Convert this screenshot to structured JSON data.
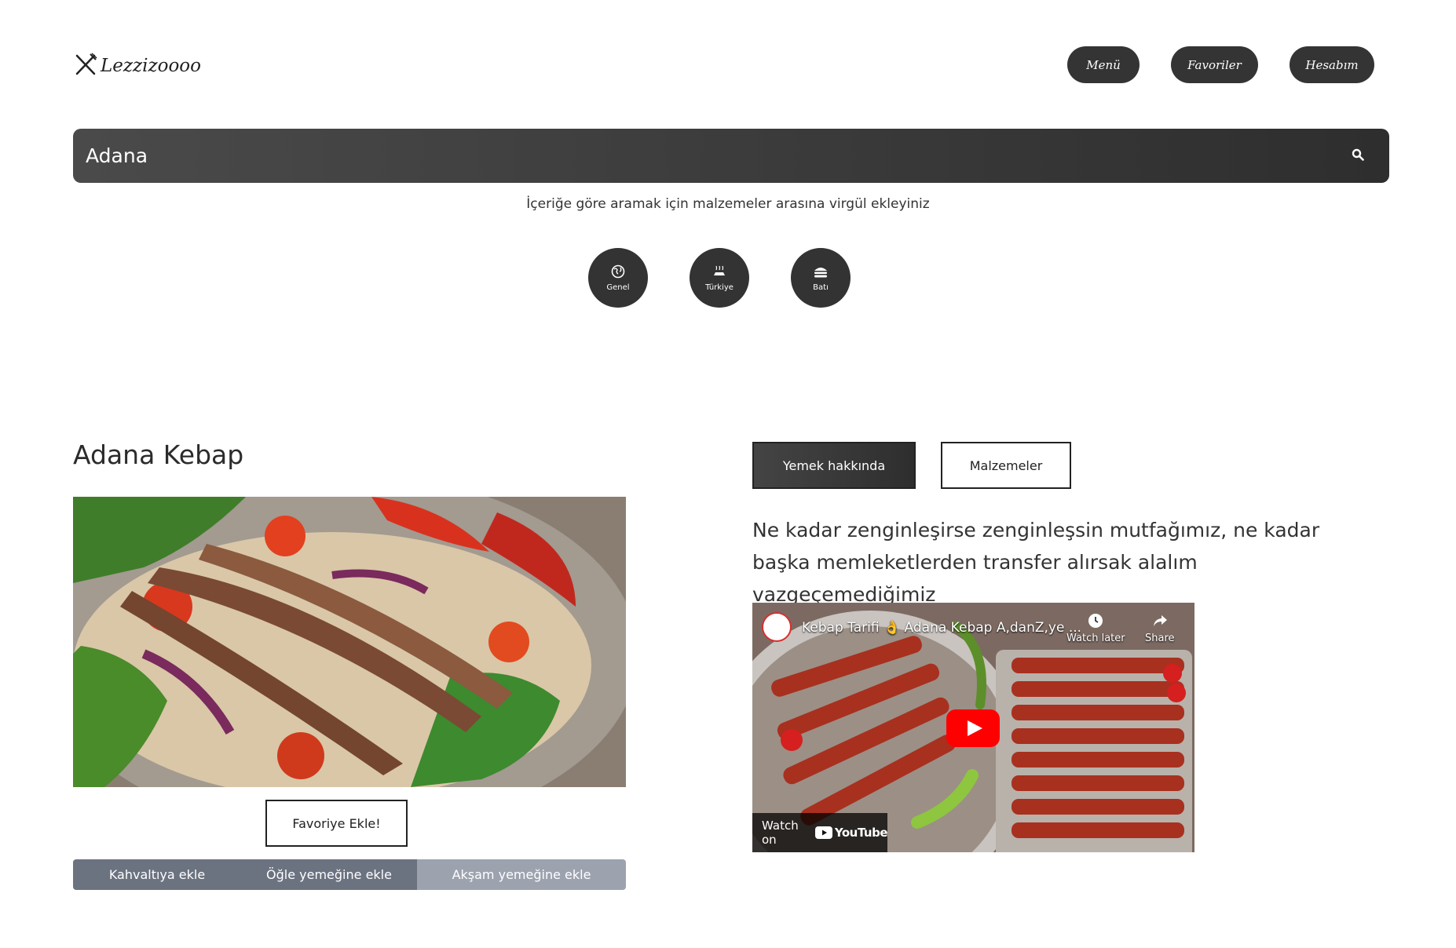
{
  "header": {
    "logo_text": "Lezzizoooo",
    "nav": [
      {
        "label": "Menü"
      },
      {
        "label": "Favoriler"
      },
      {
        "label": "Hesabım"
      }
    ]
  },
  "search": {
    "value": "Adana",
    "hint": "İçeriğe göre aramak için malzemeler arasına virgül ekleyiniz"
  },
  "categories": [
    {
      "label": "Genel",
      "icon": "globe-icon"
    },
    {
      "label": "Türkiye",
      "icon": "kebab-icon"
    },
    {
      "label": "Batı",
      "icon": "burger-icon"
    }
  ],
  "recipe": {
    "title": "Adana Kebap",
    "favorite_label": "Favoriye Ekle!",
    "meals": [
      {
        "label": "Kahvaltıya ekle",
        "color": "#6b7280"
      },
      {
        "label": "Öğle yemeğine ekle",
        "color": "#6b7280"
      },
      {
        "label": "Akşam yemeğine ekle",
        "color": "#9ca3af"
      }
    ],
    "tabs": [
      {
        "label": "Yemek hakkında",
        "active": true
      },
      {
        "label": "Malzemeler",
        "active": false
      }
    ],
    "description": "Ne kadar zenginleşirse zenginleşsin mutfağımız, ne kadar başka memleketlerden transfer alırsak alalım vazgeçemediğimiz",
    "video": {
      "title": "Kebap Tarifi 👌 Adana Kebap A,danZ,ye ...",
      "watch_later": "Watch later",
      "share": "Share",
      "watch_on": "Watch on",
      "youtube": "YouTube"
    }
  },
  "colors": {
    "dark": "#343434",
    "youtube_red": "#ff0000"
  }
}
